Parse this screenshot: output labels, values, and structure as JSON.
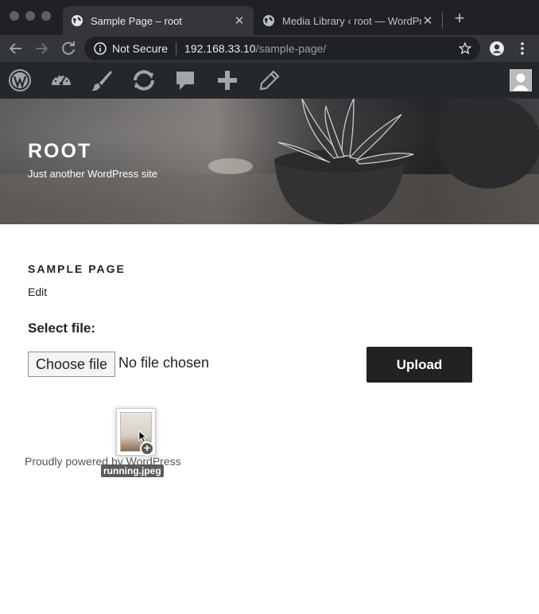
{
  "browser": {
    "tabs": [
      {
        "title": "Sample Page – root",
        "active": true
      },
      {
        "title": "Media Library ‹ root — WordPr",
        "active": false
      }
    ],
    "new_tab_label": "+",
    "address": {
      "security_label": "Not Secure",
      "host": "192.168.33.10",
      "path": "/sample-page/"
    }
  },
  "admin_bar": {
    "items": [
      "wordpress-logo-icon",
      "dashboard-icon",
      "customize-brush-icon",
      "updates-icon",
      "comments-icon",
      "new-content-icon",
      "edit-pencil-icon"
    ],
    "background": "#23282d"
  },
  "site": {
    "title": "ROOT",
    "description": "Just another WordPress site"
  },
  "page": {
    "heading": "SAMPLE PAGE",
    "edit_label": "Edit",
    "form": {
      "label": "Select file:",
      "choose_button": "Choose file",
      "file_status": "No file chosen",
      "upload_button": "Upload"
    }
  },
  "footer": {
    "text": "Proudly powered by WordPress"
  },
  "drag": {
    "file_name": "running.jpeg",
    "badge": "+"
  }
}
